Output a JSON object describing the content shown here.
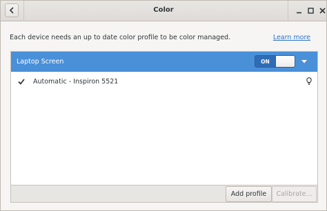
{
  "window": {
    "title": "Color"
  },
  "info": {
    "text": "Each device needs an up to date color profile to be color managed.",
    "learn_more": "Learn more"
  },
  "device": {
    "name": "Laptop Screen",
    "switch_label": "ON",
    "switch_state": "on"
  },
  "profiles": [
    {
      "name": "Automatic - Inspiron 5521",
      "active": true
    }
  ],
  "buttons": {
    "add_profile": "Add profile",
    "calibrate": "Calibrate..."
  },
  "colors": {
    "accent": "#4a90d9",
    "link": "#2a76c6",
    "window_bg": "#f6f5f4"
  },
  "icons": {
    "back": "chevron-left-icon",
    "minimize": "minimize-icon",
    "maximize": "maximize-icon",
    "close": "close-icon",
    "dropdown": "chevron-down-icon",
    "check": "checkmark-icon",
    "bulb": "lightbulb-icon"
  }
}
